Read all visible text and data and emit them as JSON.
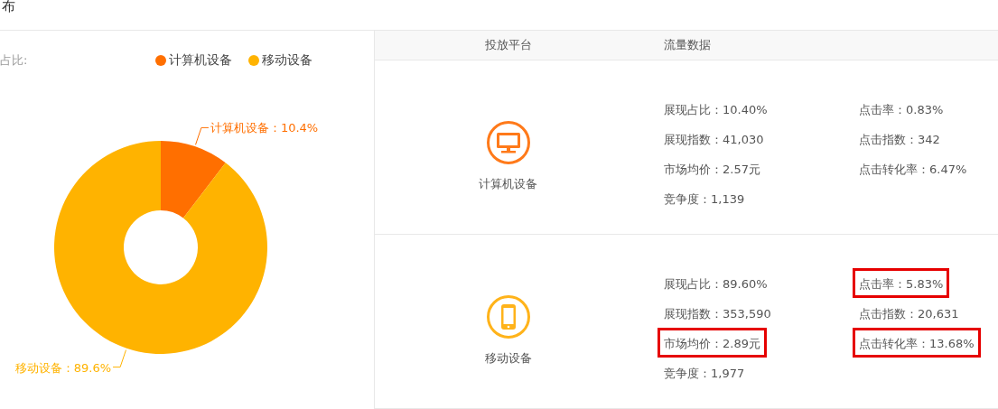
{
  "title": "布",
  "chart_panel": {
    "label": "占比:",
    "chart_data": {
      "type": "donut",
      "categories": [
        "计算机设备",
        "移动设备"
      ],
      "values": [
        10.4,
        89.6
      ],
      "colors": [
        "#ff6f00",
        "#ffb300"
      ],
      "annotations": [
        {
          "text": "计算机设备：10.4%"
        },
        {
          "text": "移动设备：89.6%"
        }
      ]
    }
  },
  "table": {
    "columns": [
      "投放平台",
      "流量数据"
    ],
    "rows": [
      {
        "platform": "计算机设备",
        "kind": "computer",
        "color": "#ff7a1a",
        "metrics_left": [
          {
            "text": "展现占比：10.40%",
            "highlighted": false
          },
          {
            "text": "展现指数：41,030",
            "highlighted": false
          },
          {
            "text": "市场均价：2.57元",
            "highlighted": false
          },
          {
            "text": "竞争度：1,139",
            "highlighted": false
          }
        ],
        "metrics_right": [
          {
            "text": "点击率：0.83%",
            "highlighted": false
          },
          {
            "text": "点击指数：342",
            "highlighted": false
          },
          {
            "text": "点击转化率：6.47%",
            "highlighted": false
          }
        ]
      },
      {
        "platform": "移动设备",
        "kind": "phone",
        "color": "#ffb31a",
        "metrics_left": [
          {
            "text": "展现占比：89.60%",
            "highlighted": false
          },
          {
            "text": "展现指数：353,590",
            "highlighted": false
          },
          {
            "text": "市场均价：2.89元",
            "highlighted": true
          },
          {
            "text": "竞争度：1,977",
            "highlighted": false
          }
        ],
        "metrics_right": [
          {
            "text": "点击率：5.83%",
            "highlighted": true
          },
          {
            "text": "点击指数：20,631",
            "highlighted": false
          },
          {
            "text": "点击转化率：13.68%",
            "highlighted": true
          }
        ]
      }
    ]
  }
}
